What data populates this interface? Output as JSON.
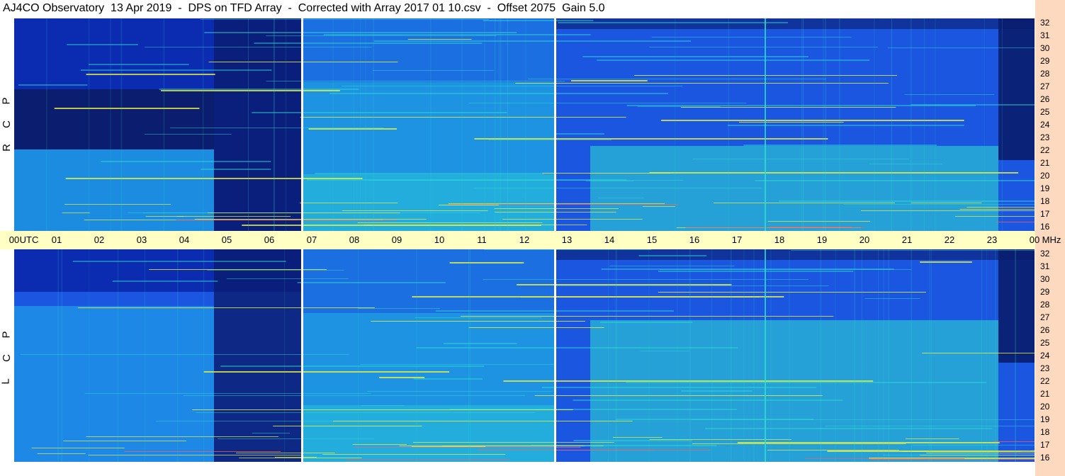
{
  "title": "AJ4CO Observatory  13 Apr 2019  -  DPS on TFD Array  -  Corrected with Array 2017 01 10.csv  -  Offset 2075  Gain 5.0",
  "utc_axis": {
    "labels": [
      "00",
      "UTC",
      "01",
      "02",
      "03",
      "04",
      "05",
      "06",
      "07",
      "08",
      "09",
      "10",
      "11",
      "12",
      "13",
      "14",
      "15",
      "16",
      "17",
      "18",
      "19",
      "20",
      "21",
      "22",
      "23",
      "00",
      "MHz"
    ],
    "hours": [
      0,
      0.35,
      1,
      2,
      3,
      4,
      5,
      6,
      7,
      8,
      9,
      10,
      11,
      12,
      13,
      14,
      15,
      16,
      17,
      18,
      19,
      20,
      21,
      22,
      23,
      24,
      24.4
    ]
  },
  "freq_axis": {
    "labels": [
      "32",
      "31",
      "30",
      "29",
      "28",
      "27",
      "26",
      "25",
      "24",
      "23",
      "22",
      "21",
      "20",
      "19",
      "18",
      "17",
      "16"
    ],
    "mhz": [
      32,
      31,
      30,
      29,
      28,
      27,
      26,
      25,
      24,
      23,
      22,
      21,
      20,
      19,
      18,
      17,
      16
    ]
  },
  "panels": [
    {
      "name": "RCP",
      "letters": [
        "R",
        "C",
        "P"
      ]
    },
    {
      "name": "LCP",
      "letters": [
        "L",
        "C",
        "P"
      ]
    }
  ],
  "colors": {
    "deep": "#0a1d6e",
    "dark": "#0b2bb0",
    "mid": "#1a56e0",
    "bright": "#1f9ee8",
    "hot": "#2fe0d0",
    "peak": "#e8f040",
    "utc_bar": "#ffffc4",
    "mhz_strip": "#fcd9bf"
  },
  "chart_data": {
    "type": "heatmap",
    "title": "AJ4CO Observatory  13 Apr 2019  -  DPS on TFD Array  -  Corrected with Array 2017 01 10.csv  -  Offset 2075  Gain 5.0",
    "x_range_utc_hours": [
      0,
      24
    ],
    "y_range_mhz": [
      16,
      32
    ],
    "x_ticks": [
      "00",
      "01",
      "02",
      "03",
      "04",
      "05",
      "06",
      "07",
      "08",
      "09",
      "10",
      "11",
      "12",
      "13",
      "14",
      "15",
      "16",
      "17",
      "18",
      "19",
      "20",
      "21",
      "22",
      "23",
      "00"
    ],
    "y_ticks": [
      "32",
      "31",
      "30",
      "29",
      "28",
      "27",
      "26",
      "25",
      "24",
      "23",
      "22",
      "21",
      "20",
      "19",
      "18",
      "17",
      "16"
    ],
    "panels": [
      "RCP",
      "LCP"
    ],
    "data_gaps_utc": [
      6.75,
      12.7
    ]
  }
}
